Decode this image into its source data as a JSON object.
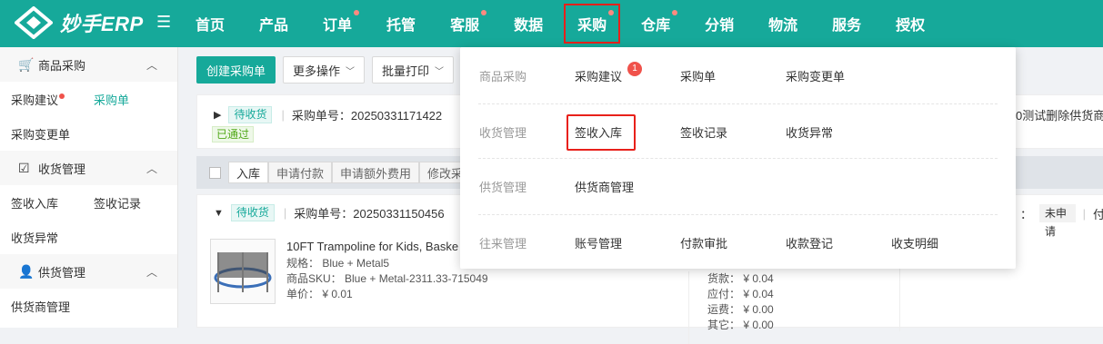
{
  "app": {
    "title": "妙手ERP"
  },
  "colors": {
    "brand": "#16a99a",
    "highlight": "#e8201a",
    "badge": "#f0524b"
  },
  "nav": {
    "items": [
      {
        "label": "首页",
        "dot": false
      },
      {
        "label": "产品",
        "dot": false
      },
      {
        "label": "订单",
        "dot": true
      },
      {
        "label": "托管",
        "dot": false
      },
      {
        "label": "客服",
        "dot": true
      },
      {
        "label": "数据",
        "dot": false
      },
      {
        "label": "采购",
        "dot": true,
        "active": true
      },
      {
        "label": "仓库",
        "dot": true
      },
      {
        "label": "分销",
        "dot": false
      },
      {
        "label": "物流",
        "dot": false
      },
      {
        "label": "服务",
        "dot": false
      },
      {
        "label": "授权",
        "dot": false
      }
    ]
  },
  "sidebar": {
    "groups": [
      {
        "label": "商品采购",
        "icon": "cart-icon",
        "items": [
          "采购建议",
          "采购单",
          "采购变更单"
        ]
      },
      {
        "label": "收货管理",
        "icon": "clipboard-check-icon",
        "items": [
          "签收入库",
          "签收记录",
          "收货异常"
        ]
      },
      {
        "label": "供货管理",
        "icon": "supplier-icon",
        "items": [
          "供货商管理"
        ]
      }
    ],
    "active_item": "采购单"
  },
  "toolbar": {
    "create": "创建采购单",
    "more": "更多操作",
    "batch_print": "批量打印"
  },
  "order1": {
    "status": "待收货",
    "number_label": "采购单号：20250331171422",
    "approval": "已通过",
    "right_text": "0测试删除供货商"
  },
  "batch_bar": {
    "buttons": [
      "入库",
      "申请付款",
      "申请额外费用",
      "修改采"
    ]
  },
  "order2": {
    "status": "待收货",
    "number_label": "采购单号：20250331150456",
    "right_colon": "：",
    "right_tag": "未申请",
    "right_extra": "付",
    "product": {
      "name": "10FT Trampoline for Kids, Baske",
      "spec": "规格： Blue + Metal5",
      "sku": "商品SKU： Blue + Metal-2311.33-715049",
      "price": "单价： ¥ 0.01"
    },
    "fees": [
      "货款： ¥ 0.04",
      "应付： ¥ 0.04",
      "运费： ¥ 0.00",
      "其它： ¥ 0.00"
    ]
  },
  "dropdown": {
    "sections": [
      {
        "title": "商品采购",
        "links": [
          "采购建议",
          "采购单",
          "采购变更单"
        ]
      },
      {
        "title": "收货管理",
        "links": [
          "签收入库",
          "签收记录",
          "收货异常"
        ]
      },
      {
        "title": "供货管理",
        "links": [
          "供货商管理"
        ]
      },
      {
        "title": "往来管理",
        "links": [
          "账号管理",
          "付款审批",
          "收款登记",
          "收支明细"
        ]
      }
    ],
    "badge": "1"
  }
}
